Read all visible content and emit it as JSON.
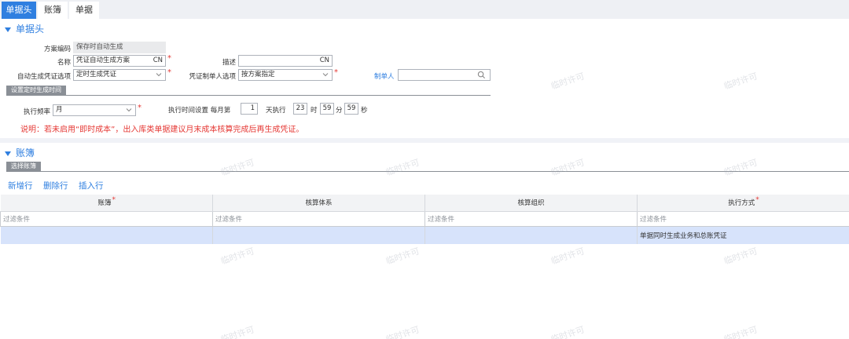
{
  "tabs": [
    {
      "label": "单据头",
      "active": true
    },
    {
      "label": "账簿",
      "active": false
    },
    {
      "label": "单据",
      "active": false
    }
  ],
  "header_section": {
    "title": "单据头",
    "scheme_code": {
      "label": "方案编码",
      "value": "保存时自动生成"
    },
    "name": {
      "label": "名称",
      "value": "凭证自动生成方案",
      "lang": "CN"
    },
    "description": {
      "label": "描述",
      "value": "",
      "lang": "CN"
    },
    "auto_option": {
      "label": "自动生成凭证选项",
      "value": "定时生成凭证"
    },
    "maker_option": {
      "label": "凭证制单人选项",
      "value": "按方案指定"
    },
    "maker": {
      "label": "制单人",
      "value": ""
    },
    "schedule_title": "设置定时生成时间",
    "frequency": {
      "label": "执行频率",
      "value": "月"
    },
    "time_setting": {
      "label": "执行时间设置",
      "prefix": "每月第",
      "day": "1",
      "day_suffix": "天执行",
      "hour": "23",
      "hour_unit": "时",
      "minute": "59",
      "minute_unit": "分",
      "second": "59",
      "second_unit": "秒"
    },
    "note": "说明：若未启用“即时成本”，出入库类单据建议月末成本核算完成后再生成凭证。"
  },
  "ledger_section": {
    "title": "账簿",
    "select_label": "选择账簿",
    "actions": [
      "新增行",
      "删除行",
      "插入行"
    ],
    "columns": [
      {
        "label": "账簿",
        "required": true
      },
      {
        "label": "核算体系",
        "required": false
      },
      {
        "label": "核算组织",
        "required": false
      },
      {
        "label": "执行方式",
        "required": true
      }
    ],
    "filter_placeholder": "过滤条件",
    "rows": [
      [
        "",
        "",
        "",
        "单据同时生成业务和总账凭证"
      ]
    ]
  },
  "watermark": "临时许可",
  "colors": {
    "accent": "#2f7fe0",
    "required": "#e53935",
    "selected_row": "#d7e3fb"
  }
}
